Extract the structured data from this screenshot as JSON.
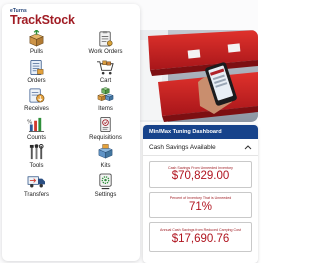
{
  "brand": {
    "top": "eTurns",
    "name": "TrackStock"
  },
  "tiles": [
    {
      "label": "Pulls",
      "icon": "box-arrow-icon"
    },
    {
      "label": "Work Orders",
      "icon": "clipboard-icon"
    },
    {
      "label": "Orders",
      "icon": "order-list-icon"
    },
    {
      "label": "Cart",
      "icon": "cart-icon"
    },
    {
      "label": "Receives",
      "icon": "receive-box-icon"
    },
    {
      "label": "Items",
      "icon": "cubes-icon"
    },
    {
      "label": "Counts",
      "icon": "count-chart-icon"
    },
    {
      "label": "Requisitions",
      "icon": "requisition-icon"
    },
    {
      "label": "Tools",
      "icon": "tools-icon"
    },
    {
      "label": "Kits",
      "icon": "kits-icon"
    },
    {
      "label": "Transfers",
      "icon": "truck-icon"
    },
    {
      "label": "Settings",
      "icon": "settings-icon"
    }
  ],
  "dashboard": {
    "title": "Min/Max Tuning Dashboard",
    "section": "Cash Savings Available",
    "metrics": [
      {
        "label": "Cash Savings From Unneeded Inventory",
        "value": "$70,829.00"
      },
      {
        "label": "Percent of Inventory That is Unneeded",
        "value": "71%"
      },
      {
        "label": "Annual Cash Savings from Reduced Carrying Cost",
        "value": "$17,690.76"
      }
    ]
  },
  "colors": {
    "brand_red": "#a11d25",
    "header_blue": "#17438b",
    "metric_red": "#b0141f"
  }
}
